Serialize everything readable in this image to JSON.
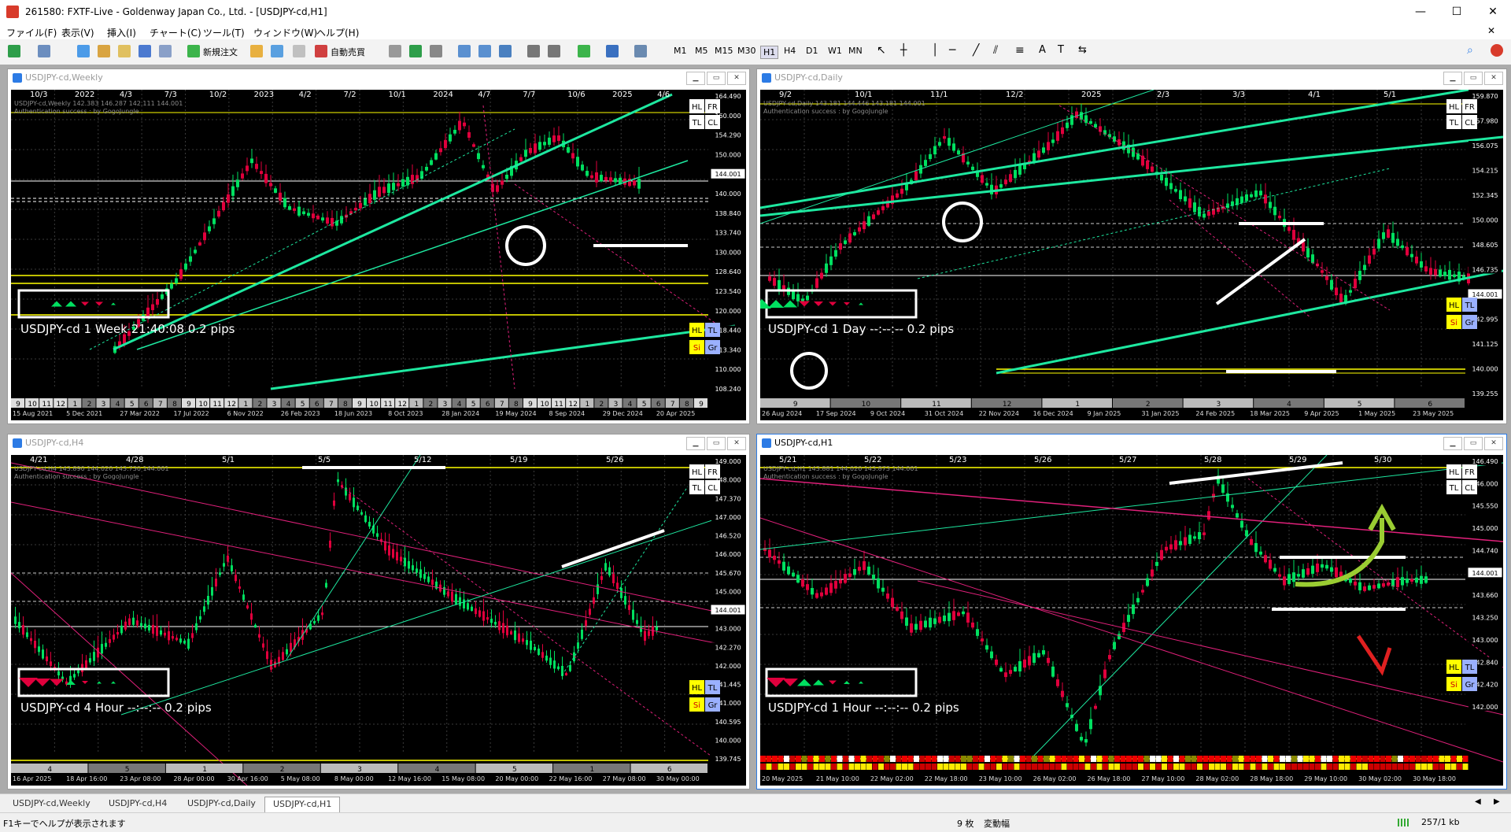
{
  "app": {
    "title": "261580: FXTF-Live - Goldenway Japan Co., Ltd. - [USDJPY-cd,H1]",
    "minimize": "—",
    "maximize": "☐",
    "close": "✕"
  },
  "menu": [
    "ファイル(F)",
    "表示(V)",
    "挿入(I)",
    "チャート(C)",
    "ツール(T)",
    "ウィンドウ(W)",
    "ヘルプ(H)"
  ],
  "toolbar": {
    "new_order": "新規注文",
    "auto_trade": "自動売買",
    "timeframes": [
      "M1",
      "M5",
      "M15",
      "M30",
      "H1",
      "H4",
      "D1",
      "W1",
      "MN"
    ],
    "active_timeframe": "H1"
  },
  "windows": {
    "weekly": {
      "title": "USDJPY-cd,Weekly",
      "info": "USDJPY-cd,Weekly 142.383 146.287 142.111 144.001",
      "auth": "Authentication success : by GogoJungle",
      "top_labels": [
        "10/3",
        "2022",
        "4/3",
        "7/3",
        "10/2",
        "2023",
        "4/2",
        "7/2",
        "10/1",
        "2024",
        "4/7",
        "7/7",
        "10/6",
        "2025",
        "4/6"
      ],
      "prices": [
        "164.490",
        "160.000",
        "154.290",
        "150.000",
        "144.001",
        "140.000",
        "138.840",
        "133.740",
        "130.000",
        "128.640",
        "123.540",
        "120.000",
        "118.440",
        "113.340",
        "110.000",
        "108.240"
      ],
      "status": "USDJPY-cd  1 Week  21:40:08  0.2 pips",
      "bottom_nums": [
        "9",
        "10",
        "11",
        "12",
        "1",
        "2",
        "3",
        "4",
        "5",
        "6",
        "7",
        "8",
        "9",
        "10",
        "11",
        "12",
        "1",
        "2",
        "3",
        "4",
        "5",
        "6",
        "7",
        "8",
        "9",
        "10",
        "11",
        "12",
        "1",
        "2",
        "3",
        "4",
        "5",
        "6",
        "7",
        "8",
        "9",
        "10",
        "11",
        "12",
        "1",
        "2",
        "3",
        "4",
        "5",
        "6",
        "7",
        "8",
        "9"
      ],
      "dates": [
        "15 Aug 2021",
        "5 Dec 2021",
        "27 Mar 2022",
        "17 Jul 2022",
        "6 Nov 2022",
        "26 Feb 2023",
        "18 Jun 2023",
        "8 Oct 2023",
        "28 Jan 2024",
        "19 May 2024",
        "8 Sep 2024",
        "29 Dec 2024",
        "20 Apr 2025"
      ]
    },
    "daily": {
      "title": "USDJPY-cd,Daily",
      "info": "USDJPY-cd,Daily 143.181 144.446 143.181 144.001",
      "auth": "Authentication success : by GogoJungle",
      "top_labels": [
        "9/2",
        "10/1",
        "11/1",
        "12/2",
        "2025",
        "2/3",
        "3/3",
        "4/1",
        "5/1"
      ],
      "prices": [
        "159.870",
        "157.980",
        "156.075",
        "154.215",
        "152.345",
        "150.000",
        "148.605",
        "146.735",
        "144.001",
        "142.995",
        "141.125",
        "140.000",
        "139.255"
      ],
      "status": "USDJPY-cd  1 Day  --:--:--  0.2 pips",
      "bottom_nums": [
        "9",
        "10",
        "11",
        "12",
        "1",
        "2",
        "3",
        "4",
        "5",
        "6"
      ],
      "dates": [
        "26 Aug 2024",
        "17 Sep 2024",
        "9 Oct 2024",
        "31 Oct 2024",
        "22 Nov 2024",
        "16 Dec 2024",
        "9 Jan 2025",
        "31 Jan 2025",
        "24 Feb 2025",
        "18 Mar 2025",
        "9 Apr 2025",
        "1 May 2025",
        "23 May 2025"
      ]
    },
    "h4": {
      "title": "USDJPY-cd,H4",
      "info": "USDJPY-cd,H4 143.890 144.020 143.730 144.001",
      "auth": "Authentication success : by GogoJungle",
      "top_labels": [
        "4/21",
        "4/28",
        "5/1",
        "5/5",
        "5/12",
        "5/19",
        "5/26"
      ],
      "prices": [
        "149.000",
        "148.000",
        "147.370",
        "147.000",
        "146.520",
        "146.000",
        "145.670",
        "145.000",
        "144.001",
        "143.000",
        "142.270",
        "142.000",
        "141.445",
        "141.000",
        "140.595",
        "140.000",
        "139.745"
      ],
      "status": "USDJPY-cd  4 Hour  --:--:--  0.2 pips",
      "bottom_nums": [
        "4",
        "5",
        "1",
        "2",
        "3",
        "4",
        "5",
        "1",
        "6"
      ],
      "dates": [
        "16 Apr 2025",
        "18 Apr 16:00",
        "23 Apr 08:00",
        "28 Apr 00:00",
        "30 Apr 16:00",
        "5 May 08:00",
        "8 May 00:00",
        "12 May 16:00",
        "15 May 08:00",
        "20 May 00:00",
        "22 May 16:00",
        "27 May 08:00",
        "30 May 00:00"
      ]
    },
    "h1": {
      "title": "USDJPY-cd,H1",
      "info": "USDJPY-cd,H1 143.881 144.020 143.873 144.001",
      "auth": "Authentication success : by GogoJungle",
      "top_labels": [
        "5/21",
        "5/22",
        "5/23",
        "5/26",
        "5/27",
        "5/28",
        "5/29",
        "5/30"
      ],
      "prices": [
        "146.490",
        "146.000",
        "145.550",
        "145.000",
        "144.740",
        "144.001",
        "143.660",
        "143.250",
        "143.000",
        "142.840",
        "142.420",
        "142.000"
      ],
      "status": "USDJPY-cd  1 Hour  --:--:--  0.2 pips",
      "dates": [
        "20 May 2025",
        "21 May 10:00",
        "22 May 02:00",
        "22 May 18:00",
        "23 May 10:00",
        "26 May 02:00",
        "26 May 18:00",
        "27 May 10:00",
        "28 May 02:00",
        "28 May 18:00",
        "29 May 10:00",
        "30 May 02:00",
        "30 May 18:00"
      ]
    }
  },
  "tags": {
    "hl": "HL",
    "fr": "FR",
    "tl": "TL",
    "cl": "CL",
    "si": "Si",
    "gr": "Gr"
  },
  "tabs": [
    "USDJPY-cd,Weekly",
    "USDJPY-cd,H4",
    "USDJPY-cd,Daily",
    "USDJPY-cd,H1"
  ],
  "active_tab": "USDJPY-cd,H1",
  "status": {
    "help": "F1キーでヘルプが表示されます",
    "count": "9 枚",
    "mode": "変動幅",
    "conn": "257/1 kb"
  },
  "colors": {
    "bull": "#00e060",
    "bear": "#e0003c",
    "accent_line": "#1ee8a0",
    "yellow": "#ffff00",
    "magenta": "#e0207a"
  }
}
